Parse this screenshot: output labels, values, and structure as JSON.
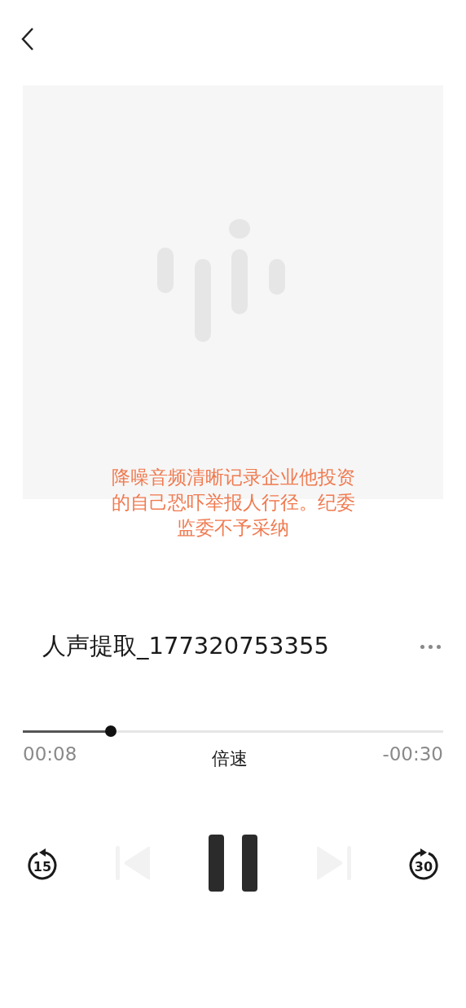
{
  "subtitle": "降噪音频清晰记录企业他投资的自己恐吓举报人行径。纪委监委不予采纳",
  "track": {
    "title": "人声提取_177320753355"
  },
  "progress": {
    "level": 0.21,
    "elapsed": "00:08",
    "remaining": "-00:30"
  },
  "speed_button": "倍速",
  "controls": {
    "skip_back": "15",
    "skip_forward": "30",
    "previous_disabled": true,
    "next_disabled": true,
    "playing": true
  }
}
